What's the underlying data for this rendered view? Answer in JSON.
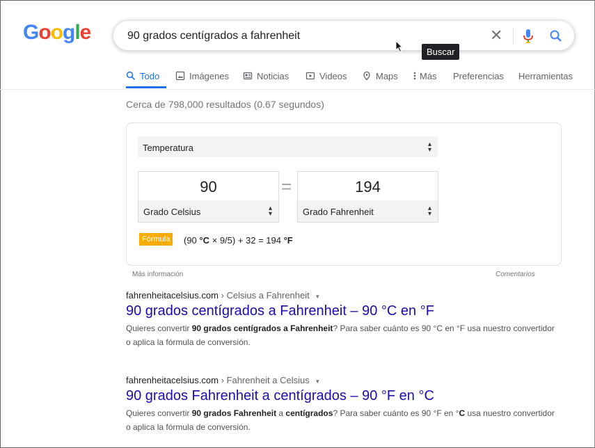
{
  "logo": {
    "letters": [
      "G",
      "o",
      "o",
      "g",
      "l",
      "e"
    ]
  },
  "search": {
    "query": "90 grados centígrados a fahrenheit",
    "tooltip": "Buscar"
  },
  "tabs": [
    {
      "label": "Todo",
      "icon": "search-icon"
    },
    {
      "label": "Imágenes",
      "icon": "image-icon"
    },
    {
      "label": "Noticias",
      "icon": "news-icon"
    },
    {
      "label": "Videos",
      "icon": "video-icon"
    },
    {
      "label": "Maps",
      "icon": "map-pin-icon"
    },
    {
      "label": "Más",
      "icon": "more-icon"
    },
    {
      "label": "Preferencias"
    },
    {
      "label": "Herramientas"
    }
  ],
  "stats": "Cerca de 798,000 resultados (0.67 segundos)",
  "converter": {
    "unit_type": "Temperatura",
    "left_value": "90",
    "left_unit": "Grado Celsius",
    "right_value": "194",
    "right_unit": "Grado Fahrenheit",
    "equals": "=",
    "formula_label": "Fórmula",
    "formula_parts": [
      "(90 ",
      "°C",
      " × 9/5) + 32 = 194 ",
      "°F"
    ],
    "more_info": "Más información",
    "feedback": "Comentarios"
  },
  "results": [
    {
      "domain": "fahrenheitacelsius.com",
      "path": " › Celsius a Fahrenheit",
      "title": "90 grados centígrados a Fahrenheit – 90 °C en °F",
      "snippet_parts": [
        "Quieres convertir ",
        "90 grados centígrados a Fahrenheit",
        "? Para saber cuánto es 90 °C en °F usa nuestro convertidor o aplica la fórmula de conversión."
      ]
    },
    {
      "domain": "fahrenheitacelsius.com",
      "path": " › Fahrenheit a Celsius",
      "title": "90 grados Fahrenheit a centígrados – 90 °F en °C",
      "snippet_parts": [
        "Quieres convertir ",
        "90 grados Fahrenheit",
        " a ",
        "centígrados",
        "? Para saber cuánto es 90 °F en °",
        "C",
        " usa nuestro convertidor o aplica la fórmula de conversión."
      ]
    }
  ],
  "colors": {
    "accent": "#1a73e8",
    "link": "#1a0dab",
    "formula_badge": "#f9ab00"
  }
}
